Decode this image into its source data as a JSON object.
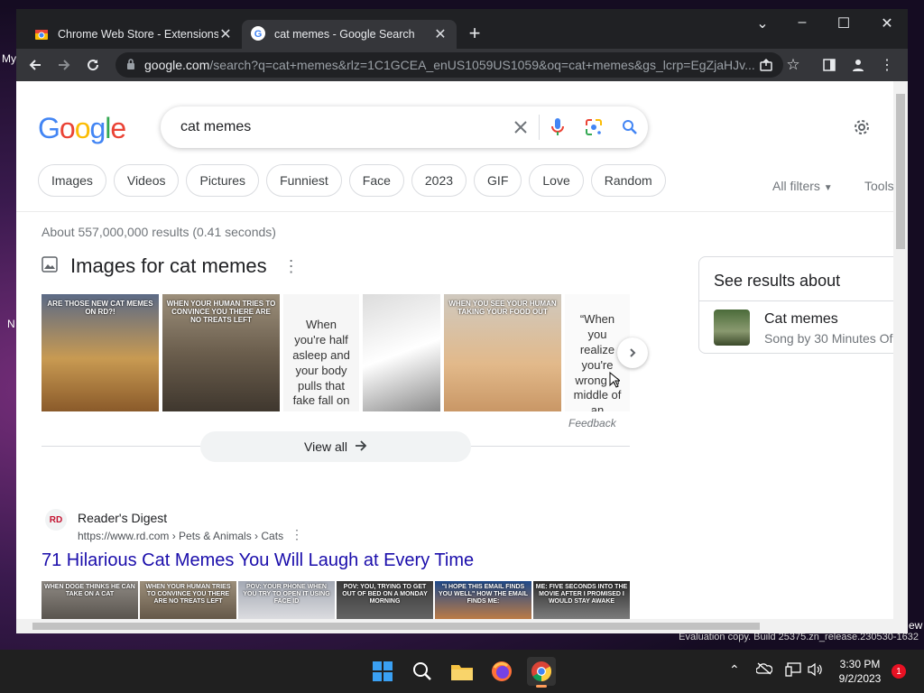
{
  "desktop": {
    "left_texts": [
      "My",
      "N"
    ],
    "right_text": "ew",
    "watermark": "Evaluation copy. Build 25375.zn_release.230530-1632"
  },
  "tabs": [
    {
      "label": "Chrome Web Store - Extensions",
      "active": false,
      "icon": "chrome-web-store-icon"
    },
    {
      "label": "cat memes - Google Search",
      "active": true,
      "icon": "google-g-icon"
    }
  ],
  "address_bar": {
    "host": "google.com",
    "path": "/search?q=cat+memes&rlz=1C1GCEA_enUS1059US1059&oq=cat+memes&gs_lcrp=EgZjaHJv..."
  },
  "google": {
    "logo": "Google",
    "query": "cat memes",
    "chips": [
      "Images",
      "Videos",
      "Pictures",
      "Funniest",
      "Face",
      "2023",
      "GIF",
      "Love",
      "Random"
    ],
    "all_filters": "All filters",
    "tools": "Tools",
    "stats": "About 557,000,000 results (0.41 seconds)",
    "images_heading": "Images for cat memes",
    "image_captions": [
      "ARE THOSE NEW CAT MEMES ON RD?!",
      "WHEN YOUR HUMAN TRIES TO CONVINCE YOU THERE ARE NO TREATS LEFT",
      "When you're half asleep and your body pulls that fake fall on you",
      "",
      "WHEN YOU SEE YOUR HUMAN TAKING YOUR FOOD OUT",
      "“When you realize you're wrong in middle of an argument”"
    ],
    "feedback": "Feedback",
    "view_all": "View all",
    "side_panel": {
      "title": "See results about",
      "name": "Cat memes",
      "subtitle": "Song by 30 Minutes Of"
    },
    "result": {
      "site": "Reader's Digest",
      "favicon": "RD",
      "url": "https://www.rd.com › Pets & Animals › Cats",
      "title": "71 Hilarious Cat Memes You Will Laugh at Every Time",
      "strip_captions": [
        "WHEN DOGE THINKS HE CAN TAKE ON A CAT",
        "WHEN YOUR HUMAN TRIES TO CONVINCE YOU THERE ARE NO TREATS LEFT",
        "POV: YOUR PHONE WHEN YOU TRY TO OPEN IT USING FACE ID",
        "POV: YOU, TRYING TO GET OUT OF BED ON A MONDAY MORNING",
        "\"I HOPE THIS EMAIL FINDS YOU WELL\" HOW THE EMAIL FINDS ME:",
        "ME: FIVE SECONDS INTO THE MOVIE AFTER I PROMISED I WOULD STAY AWAKE"
      ]
    }
  },
  "taskbar": {
    "time": "3:30 PM",
    "date": "9/2/2023",
    "notifications": "1"
  },
  "colors": {
    "link": "#1a0dab",
    "chrome_dark": "#202124",
    "tab_active": "#35363a",
    "taskbar": "#202020"
  }
}
